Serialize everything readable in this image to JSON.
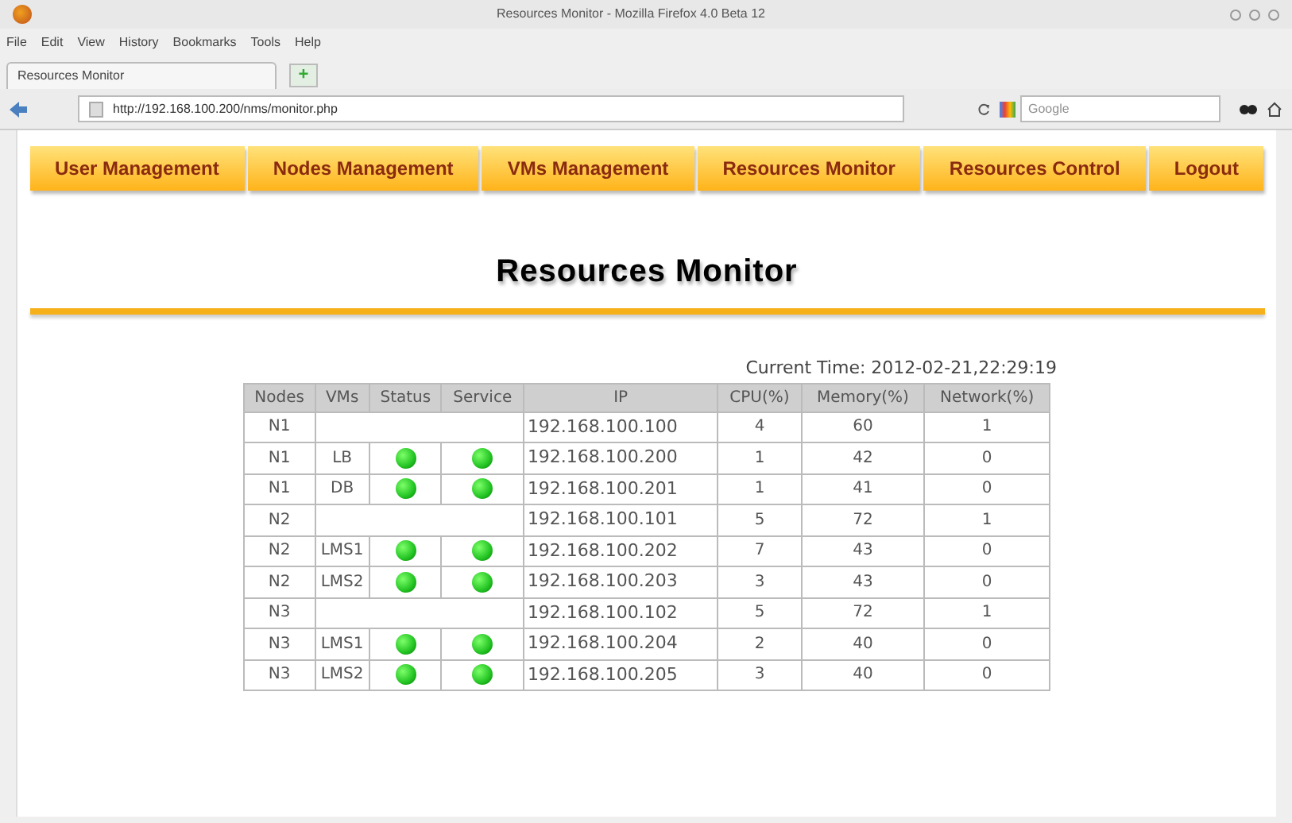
{
  "window": {
    "title": "Resources Monitor - Mozilla Firefox 4.0 Beta 12"
  },
  "menu": [
    "File",
    "Edit",
    "View",
    "History",
    "Bookmarks",
    "Tools",
    "Help"
  ],
  "tab": {
    "label": "Resources Monitor",
    "add": "+"
  },
  "address_bar": {
    "value": "http://192.168.100.200/nms/monitor.php"
  },
  "search": {
    "placeholder": "Google"
  },
  "nav": [
    "User Management",
    "Nodes Management",
    "VMs Management",
    "Resources Monitor",
    "Resources Control",
    "Logout"
  ],
  "heading": "Resources Monitor",
  "current_time": "Current Time: 2012-02-21,22:29:19",
  "table": {
    "columns": [
      "Nodes",
      "VMs",
      "Status",
      "Service",
      "IP",
      "CPU(%)",
      "Memory(%)",
      "Network(%)"
    ],
    "rows": [
      {
        "node": "N1",
        "ip": "192.168.100.100",
        "cpu": "4",
        "memory": "60",
        "network": "1"
      },
      {
        "node": "N1",
        "vm": "LB",
        "status": true,
        "service": true,
        "ip": "192.168.100.200",
        "cpu": "1",
        "memory": "42",
        "network": "0"
      },
      {
        "node": "N1",
        "vm": "DB",
        "status": true,
        "service": true,
        "ip": "192.168.100.201",
        "cpu": "1",
        "memory": "41",
        "network": "0"
      },
      {
        "node": "N2",
        "ip": "192.168.100.101",
        "cpu": "5",
        "memory": "72",
        "network": "1"
      },
      {
        "node": "N2",
        "vm": "LMS1",
        "status": true,
        "service": true,
        "ip": "192.168.100.202",
        "cpu": "7",
        "memory": "43",
        "network": "0"
      },
      {
        "node": "N2",
        "vm": "LMS2",
        "status": true,
        "service": true,
        "ip": "192.168.100.203",
        "cpu": "3",
        "memory": "43",
        "network": "0"
      },
      {
        "node": "N3",
        "ip": "192.168.100.102",
        "cpu": "5",
        "memory": "72",
        "network": "1"
      },
      {
        "node": "N3",
        "vm": "LMS1",
        "status": true,
        "service": true,
        "ip": "192.168.100.204",
        "cpu": "2",
        "memory": "40",
        "network": "0"
      },
      {
        "node": "N3",
        "vm": "LMS2",
        "status": true,
        "service": true,
        "ip": "192.168.100.205",
        "cpu": "3",
        "memory": "40",
        "network": "0"
      }
    ]
  }
}
